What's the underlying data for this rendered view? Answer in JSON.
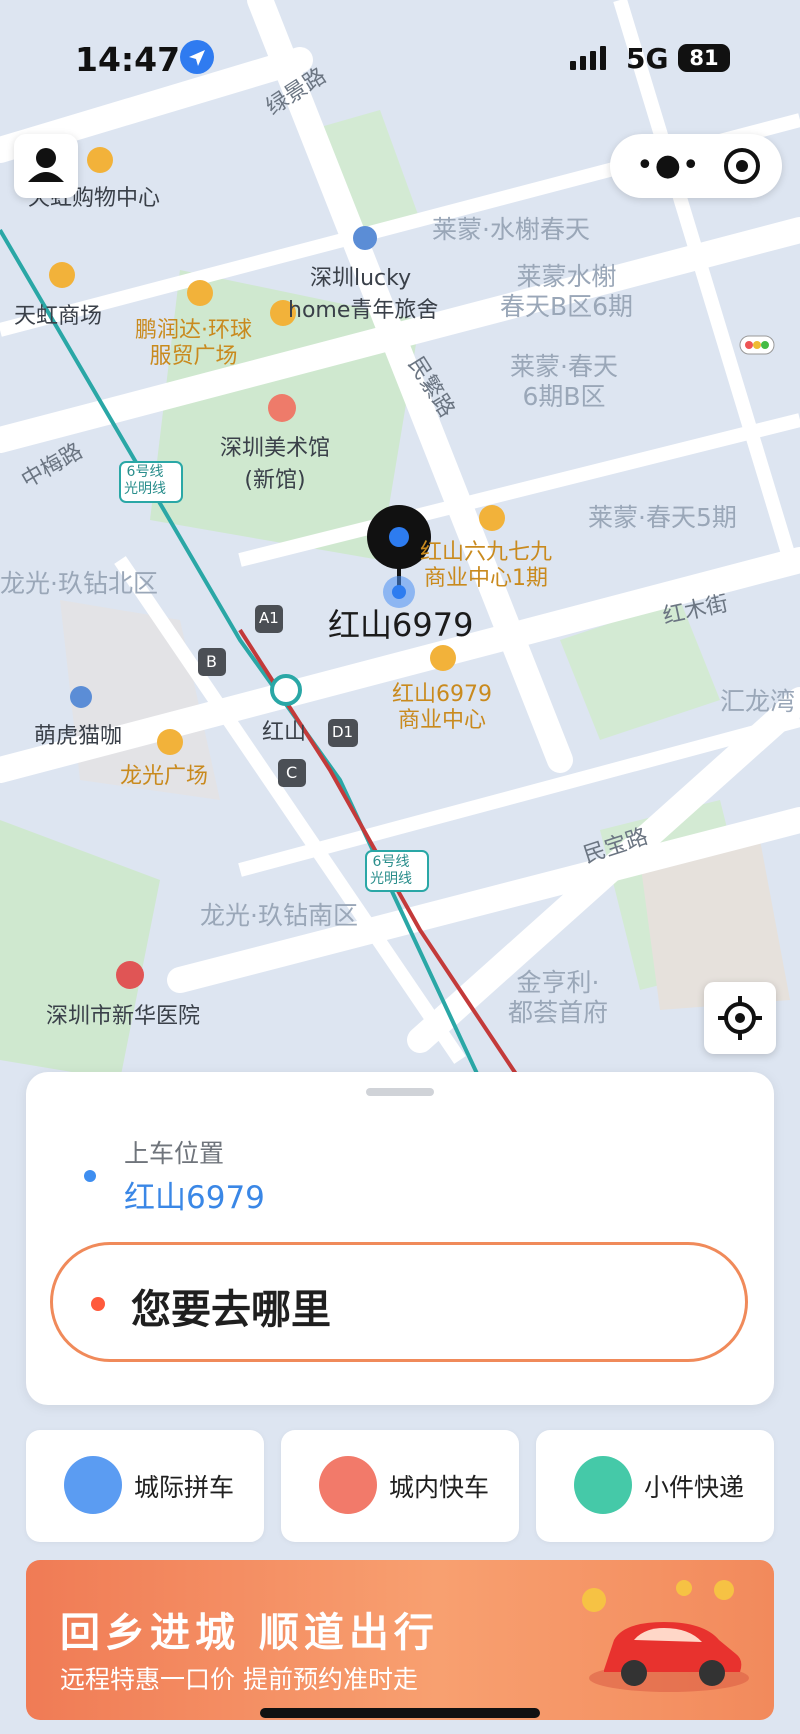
{
  "status": {
    "time": "14:47",
    "network": "5G",
    "battery": "81"
  },
  "map": {
    "labels": {
      "lujing_rd": "绿景路",
      "tianhong_center": "天虹购物中心",
      "tianhong_mall": "天虹商场",
      "youth_hostel_1": "深圳lucky",
      "youth_hostel_2": "home青年旅舍",
      "penrunda_1": "鹏润达·环球",
      "penrunda_2": "服贸广场",
      "art_museum_1": "深圳美术馆",
      "art_museum_2": "(新馆)",
      "zhongmei_rd": "中梅路",
      "metro_line6_a": "6号线\n光明线",
      "laimeng_shuixie": "莱蒙·水榭春天",
      "laimeng_b6_1": "莱蒙水榭",
      "laimeng_b6_2": "春天B区6期",
      "laimeng_6b_1": "莱蒙·春天",
      "laimeng_6b_2": "6期B区",
      "minfan_rd": "民繁路",
      "laimeng_5": "莱蒙·春天5期",
      "hongshan_697_1": "红山六九七九",
      "hongshan_697_2": "商业中心1期",
      "pin_name": "红山6979",
      "hongmu_st": "红木街",
      "huilong_bay": "汇龙湾",
      "jiuzuan_north": "龙光·玖钻北区",
      "hongshan_biz_1": "红山6979",
      "hongshan_biz_2": "商业中心",
      "menghu_cafe": "萌虎猫咖",
      "longguang_plaza": "龙光广场",
      "hongshan_station": "红山",
      "exit_a1": "A1",
      "exit_b": "B",
      "exit_c": "C",
      "exit_d1": "D1",
      "metro_line6_b": "6号线\n光明线",
      "minbao_rd": "民宝路",
      "jiuzuan_south": "龙光·玖钻南区",
      "xinhua_hospital": "深圳市新华医院",
      "jinhengli_1": "金亨利·",
      "jinhengli_2": "都荟首府"
    }
  },
  "controls": {
    "avatar_icon": "user-icon",
    "more_icon": "more-icon",
    "target_icon": "target-icon",
    "locate_icon": "locate-icon"
  },
  "ride": {
    "pickup_caption": "上车位置",
    "pickup_value": "红山6979",
    "destination_placeholder": "您要去哪里"
  },
  "services": [
    {
      "label": "城际拼车",
      "color": "#5b9cf2"
    },
    {
      "label": "城内快车",
      "color": "#f27a6a"
    },
    {
      "label": "小件快递",
      "color": "#45c9a8"
    }
  ],
  "banner": {
    "title": "回乡进城 顺道出行",
    "subtitle": "远程特惠一口价  提前预约准时走"
  }
}
